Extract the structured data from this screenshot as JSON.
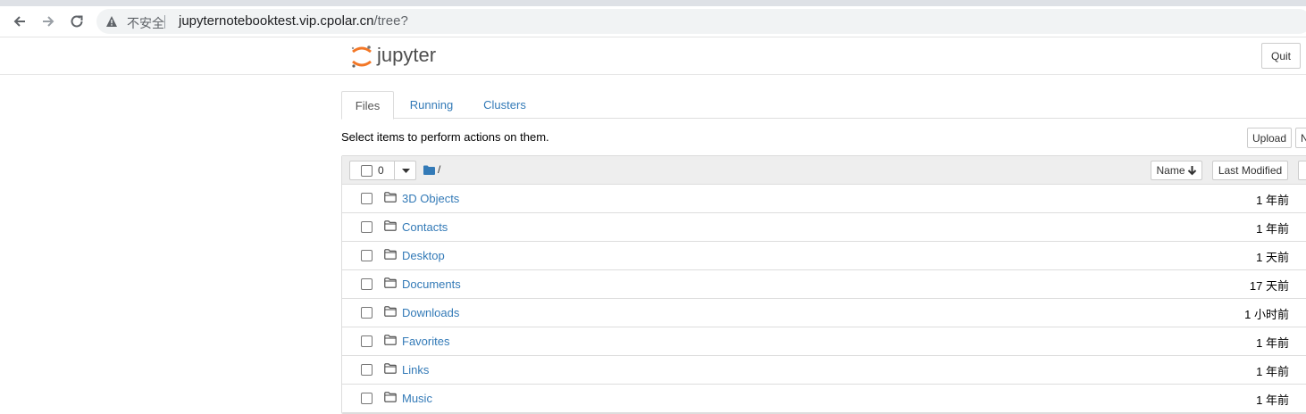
{
  "browser": {
    "security_label": "不安全",
    "url_host": "jupyternotebooktest.vip.cpolar.cn",
    "url_path": "/tree?",
    "icons": {
      "back": "arrow-left-icon",
      "forward": "arrow-right-icon",
      "reload": "reload-icon",
      "security": "warning-triangle-icon"
    }
  },
  "header": {
    "logo_text": "jupyter",
    "quit_label": "Quit",
    "logo_color": "#f37726"
  },
  "tabs": [
    {
      "label": "Files",
      "active": true
    },
    {
      "label": "Running",
      "active": false
    },
    {
      "label": "Clusters",
      "active": false
    }
  ],
  "toolbar": {
    "hint": "Select items to perform actions on them.",
    "upload_label": "Upload",
    "new_label": "N"
  },
  "list_header": {
    "selected_count": "0",
    "breadcrumb": "/",
    "sort_name_label": "Name",
    "sort_modified_label": "Last Modified"
  },
  "files": [
    {
      "name": "3D Objects",
      "modified": "1 年前"
    },
    {
      "name": "Contacts",
      "modified": "1 年前"
    },
    {
      "name": "Desktop",
      "modified": "1 天前"
    },
    {
      "name": "Documents",
      "modified": "17 天前"
    },
    {
      "name": "Downloads",
      "modified": "1 小时前"
    },
    {
      "name": "Favorites",
      "modified": "1 年前"
    },
    {
      "name": "Links",
      "modified": "1 年前"
    },
    {
      "name": "Music",
      "modified": "1 年前"
    }
  ],
  "colors": {
    "link": "#337ab7",
    "accent": "#f37726"
  }
}
